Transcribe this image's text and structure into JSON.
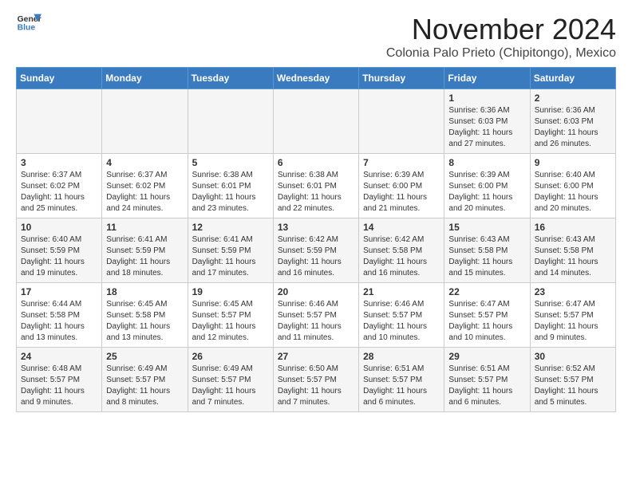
{
  "header": {
    "logo_line1": "General",
    "logo_line2": "Blue",
    "month": "November 2024",
    "location": "Colonia Palo Prieto (Chipitongo), Mexico"
  },
  "weekdays": [
    "Sunday",
    "Monday",
    "Tuesday",
    "Wednesday",
    "Thursday",
    "Friday",
    "Saturday"
  ],
  "weeks": [
    [
      {
        "day": "",
        "info": ""
      },
      {
        "day": "",
        "info": ""
      },
      {
        "day": "",
        "info": ""
      },
      {
        "day": "",
        "info": ""
      },
      {
        "day": "",
        "info": ""
      },
      {
        "day": "1",
        "info": "Sunrise: 6:36 AM\nSunset: 6:03 PM\nDaylight: 11 hours\nand 27 minutes."
      },
      {
        "day": "2",
        "info": "Sunrise: 6:36 AM\nSunset: 6:03 PM\nDaylight: 11 hours\nand 26 minutes."
      }
    ],
    [
      {
        "day": "3",
        "info": "Sunrise: 6:37 AM\nSunset: 6:02 PM\nDaylight: 11 hours\nand 25 minutes."
      },
      {
        "day": "4",
        "info": "Sunrise: 6:37 AM\nSunset: 6:02 PM\nDaylight: 11 hours\nand 24 minutes."
      },
      {
        "day": "5",
        "info": "Sunrise: 6:38 AM\nSunset: 6:01 PM\nDaylight: 11 hours\nand 23 minutes."
      },
      {
        "day": "6",
        "info": "Sunrise: 6:38 AM\nSunset: 6:01 PM\nDaylight: 11 hours\nand 22 minutes."
      },
      {
        "day": "7",
        "info": "Sunrise: 6:39 AM\nSunset: 6:00 PM\nDaylight: 11 hours\nand 21 minutes."
      },
      {
        "day": "8",
        "info": "Sunrise: 6:39 AM\nSunset: 6:00 PM\nDaylight: 11 hours\nand 20 minutes."
      },
      {
        "day": "9",
        "info": "Sunrise: 6:40 AM\nSunset: 6:00 PM\nDaylight: 11 hours\nand 20 minutes."
      }
    ],
    [
      {
        "day": "10",
        "info": "Sunrise: 6:40 AM\nSunset: 5:59 PM\nDaylight: 11 hours\nand 19 minutes."
      },
      {
        "day": "11",
        "info": "Sunrise: 6:41 AM\nSunset: 5:59 PM\nDaylight: 11 hours\nand 18 minutes."
      },
      {
        "day": "12",
        "info": "Sunrise: 6:41 AM\nSunset: 5:59 PM\nDaylight: 11 hours\nand 17 minutes."
      },
      {
        "day": "13",
        "info": "Sunrise: 6:42 AM\nSunset: 5:59 PM\nDaylight: 11 hours\nand 16 minutes."
      },
      {
        "day": "14",
        "info": "Sunrise: 6:42 AM\nSunset: 5:58 PM\nDaylight: 11 hours\nand 16 minutes."
      },
      {
        "day": "15",
        "info": "Sunrise: 6:43 AM\nSunset: 5:58 PM\nDaylight: 11 hours\nand 15 minutes."
      },
      {
        "day": "16",
        "info": "Sunrise: 6:43 AM\nSunset: 5:58 PM\nDaylight: 11 hours\nand 14 minutes."
      }
    ],
    [
      {
        "day": "17",
        "info": "Sunrise: 6:44 AM\nSunset: 5:58 PM\nDaylight: 11 hours\nand 13 minutes."
      },
      {
        "day": "18",
        "info": "Sunrise: 6:45 AM\nSunset: 5:58 PM\nDaylight: 11 hours\nand 13 minutes."
      },
      {
        "day": "19",
        "info": "Sunrise: 6:45 AM\nSunset: 5:57 PM\nDaylight: 11 hours\nand 12 minutes."
      },
      {
        "day": "20",
        "info": "Sunrise: 6:46 AM\nSunset: 5:57 PM\nDaylight: 11 hours\nand 11 minutes."
      },
      {
        "day": "21",
        "info": "Sunrise: 6:46 AM\nSunset: 5:57 PM\nDaylight: 11 hours\nand 10 minutes."
      },
      {
        "day": "22",
        "info": "Sunrise: 6:47 AM\nSunset: 5:57 PM\nDaylight: 11 hours\nand 10 minutes."
      },
      {
        "day": "23",
        "info": "Sunrise: 6:47 AM\nSunset: 5:57 PM\nDaylight: 11 hours\nand 9 minutes."
      }
    ],
    [
      {
        "day": "24",
        "info": "Sunrise: 6:48 AM\nSunset: 5:57 PM\nDaylight: 11 hours\nand 9 minutes."
      },
      {
        "day": "25",
        "info": "Sunrise: 6:49 AM\nSunset: 5:57 PM\nDaylight: 11 hours\nand 8 minutes."
      },
      {
        "day": "26",
        "info": "Sunrise: 6:49 AM\nSunset: 5:57 PM\nDaylight: 11 hours\nand 7 minutes."
      },
      {
        "day": "27",
        "info": "Sunrise: 6:50 AM\nSunset: 5:57 PM\nDaylight: 11 hours\nand 7 minutes."
      },
      {
        "day": "28",
        "info": "Sunrise: 6:51 AM\nSunset: 5:57 PM\nDaylight: 11 hours\nand 6 minutes."
      },
      {
        "day": "29",
        "info": "Sunrise: 6:51 AM\nSunset: 5:57 PM\nDaylight: 11 hours\nand 6 minutes."
      },
      {
        "day": "30",
        "info": "Sunrise: 6:52 AM\nSunset: 5:57 PM\nDaylight: 11 hours\nand 5 minutes."
      }
    ]
  ]
}
